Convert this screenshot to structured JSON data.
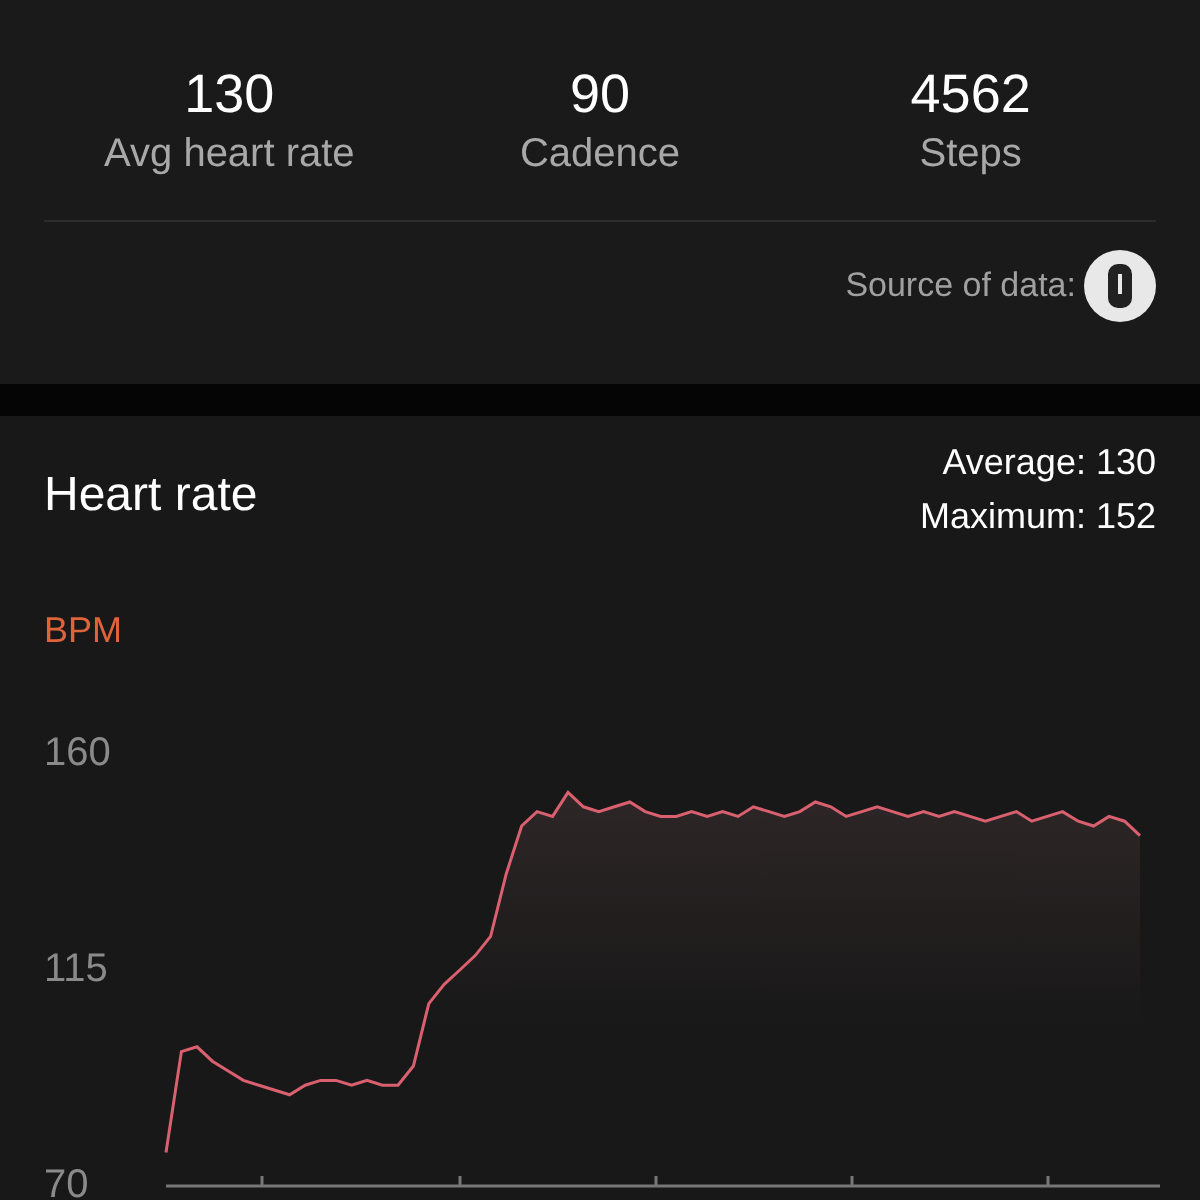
{
  "stats": [
    {
      "value": "130",
      "label": "Avg heart rate"
    },
    {
      "value": "90",
      "label": "Cadence"
    },
    {
      "value": "4562",
      "label": "Steps"
    }
  ],
  "source": {
    "label": "Source of data:"
  },
  "heart_rate": {
    "title": "Heart rate",
    "average": "Average: 130",
    "maximum": "Maximum: 152",
    "chart_data": {
      "type": "area",
      "ylabel": "BPM",
      "ylim": [
        70,
        160
      ],
      "yticks": [
        70,
        115,
        160
      ],
      "series": [
        {
          "color": "#d9606e",
          "values": [
            77,
            98,
            99,
            96,
            94,
            92,
            91,
            90,
            89,
            91,
            92,
            92,
            91,
            92,
            91,
            91,
            95,
            108,
            112,
            115,
            118,
            122,
            135,
            145,
            148,
            147,
            152,
            149,
            148,
            149,
            150,
            148,
            147,
            147,
            148,
            147,
            148,
            147,
            149,
            148,
            147,
            148,
            150,
            149,
            147,
            148,
            149,
            148,
            147,
            148,
            147,
            148,
            147,
            146,
            147,
            148,
            146,
            147,
            148,
            146,
            145,
            147,
            146,
            143
          ]
        }
      ]
    }
  }
}
